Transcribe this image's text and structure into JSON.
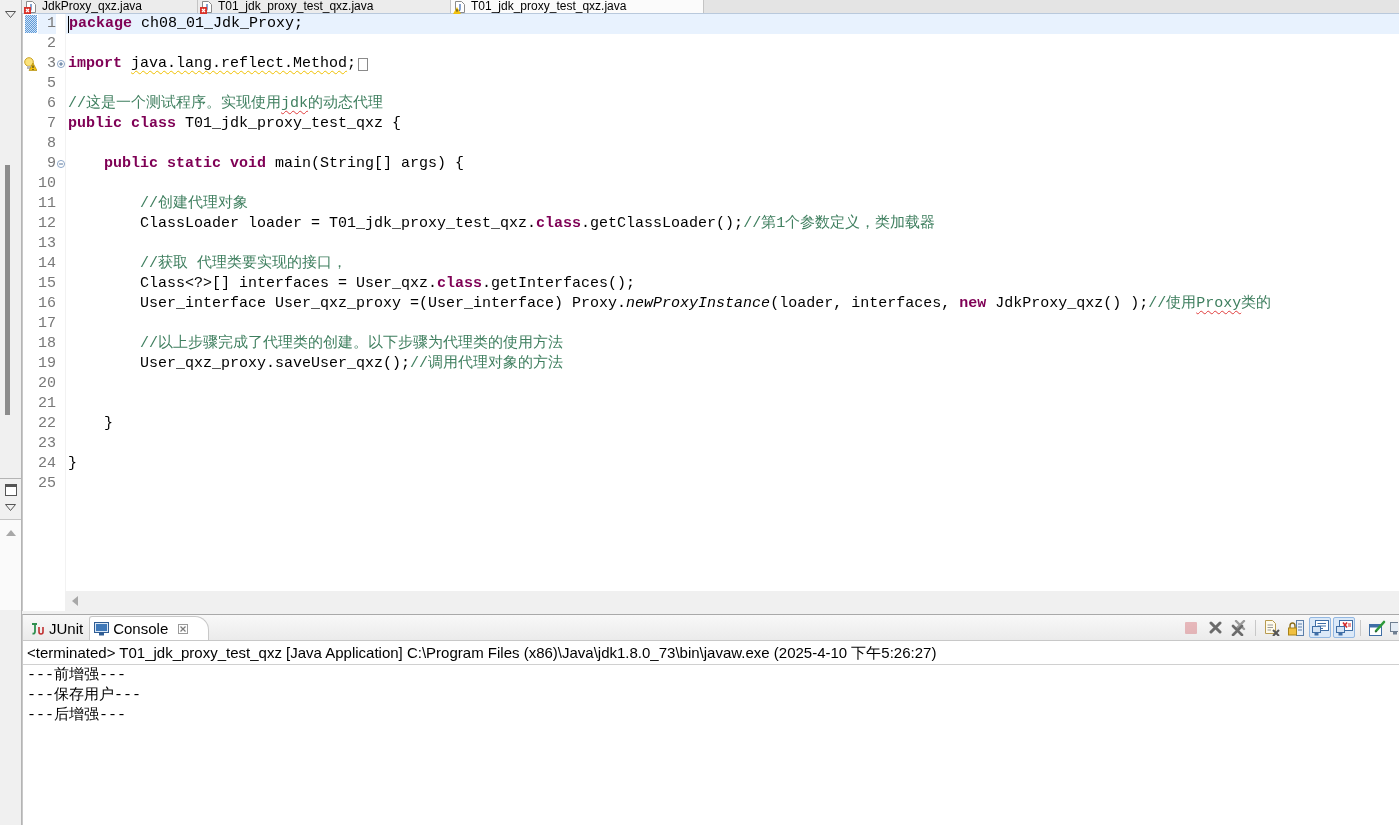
{
  "editor_tabs": [
    {
      "label": "JdkProxy_qxz.java",
      "selected": false,
      "kind": "error"
    },
    {
      "label": "T01_jdk_proxy_test_qxz.java",
      "selected": false,
      "kind": "error"
    },
    {
      "label": "T01_jdk_proxy_test_qxz.java",
      "selected": true,
      "kind": "warning"
    }
  ],
  "editor": {
    "lines": [
      {
        "number": "1",
        "current": true,
        "annotation": {
          "kind": "marker"
        },
        "spans": [
          {
            "kind": "keyword",
            "text": "package"
          },
          {
            "kind": "plain",
            "text": " ch08_01_Jdk_Proxy;"
          }
        ]
      },
      {
        "number": "2",
        "current": false
      },
      {
        "number": "3",
        "current": false,
        "annotation": {
          "kind": "warning"
        },
        "fold": {
          "expanded": false
        },
        "spans": [
          {
            "kind": "keyword",
            "text": "import "
          },
          {
            "kind": "warning",
            "text": "java.lang.reflect.Method"
          },
          {
            "kind": "plain",
            "text": ";"
          }
        ]
      },
      {
        "number": "5",
        "current": false
      },
      {
        "number": "6",
        "current": false,
        "spans": [
          {
            "kind": "comment",
            "text": "//这是一个测试程序。实现使用"
          },
          {
            "kind": "typo",
            "text": "jdk"
          },
          {
            "kind": "comment",
            "text": "的动态代理"
          }
        ]
      },
      {
        "number": "7",
        "current": false,
        "spans": [
          {
            "kind": "keyword",
            "text": "public class"
          },
          {
            "kind": "plain",
            "text": " T01_jdk_proxy_test_qxz {"
          }
        ]
      },
      {
        "number": "8",
        "current": false
      },
      {
        "number": "9",
        "current": false,
        "fold": {
          "expanded": true
        },
        "spans": [
          {
            "kind": "keyword",
            "text": "    public static void"
          },
          {
            "kind": "plain",
            "text": " main(String[] args) {"
          }
        ]
      },
      {
        "number": "10",
        "current": false
      },
      {
        "number": "11",
        "current": false,
        "spans": [
          {
            "kind": "comment",
            "text": "        //创建代理对象"
          }
        ]
      },
      {
        "number": "12",
        "current": false,
        "spans": [
          {
            "kind": "plain",
            "text": "        ClassLoader loader = T01_jdk_proxy_test_qxz."
          },
          {
            "kind": "keyword",
            "text": "class"
          },
          {
            "kind": "plain",
            "text": ".getClassLoader();"
          },
          {
            "kind": "comment",
            "text": "//第1个参数定义，类加载器"
          }
        ]
      },
      {
        "number": "13",
        "current": false
      },
      {
        "number": "14",
        "current": false,
        "spans": [
          {
            "kind": "comment",
            "text": "        //获取 代理类要实现的接口，"
          }
        ]
      },
      {
        "number": "15",
        "current": false,
        "spans": [
          {
            "kind": "plain",
            "text": "        Class<?>[] interfaces = User_qxz."
          },
          {
            "kind": "keyword",
            "text": "class"
          },
          {
            "kind": "plain",
            "text": ".getInterfaces();"
          }
        ]
      },
      {
        "number": "16",
        "current": false,
        "spans": [
          {
            "kind": "plain",
            "text": "        User_interface User_qxz_proxy =(User_interface) Proxy."
          },
          {
            "kind": "static",
            "text": "newProxyInstance"
          },
          {
            "kind": "plain",
            "text": "(loader, interfaces, "
          },
          {
            "kind": "keyword",
            "text": "new"
          },
          {
            "kind": "plain",
            "text": " JdkProxy_qxz() );"
          },
          {
            "kind": "comment",
            "text": "//使用"
          },
          {
            "kind": "typo",
            "text": "Proxy"
          },
          {
            "kind": "comment",
            "text": "类的"
          }
        ]
      },
      {
        "number": "17",
        "current": false
      },
      {
        "number": "18",
        "current": false,
        "spans": [
          {
            "kind": "comment",
            "text": "        //以上步骤完成了代理类的创建。以下步骤为代理类的使用方法"
          }
        ]
      },
      {
        "number": "19",
        "current": false,
        "spans": [
          {
            "kind": "plain",
            "text": "        User_qxz_proxy.saveUser_qxz();"
          },
          {
            "kind": "comment",
            "text": "//调用代理对象的方法"
          }
        ]
      },
      {
        "number": "20",
        "current": false
      },
      {
        "number": "21",
        "current": false
      },
      {
        "number": "22",
        "current": false,
        "spans": [
          {
            "kind": "plain",
            "text": "    }"
          }
        ]
      },
      {
        "number": "23",
        "current": false
      },
      {
        "number": "24",
        "current": false,
        "spans": [
          {
            "kind": "plain",
            "text": "}"
          }
        ]
      },
      {
        "number": "25",
        "current": false
      }
    ]
  },
  "console": {
    "tabs": [
      {
        "label": "JUnit",
        "selected": false
      },
      {
        "label": "Console",
        "selected": true
      }
    ],
    "toolbar": [
      [
        {
          "disabled": true,
          "pressed": false
        },
        {
          "disabled": false,
          "pressed": false
        },
        {
          "disabled": false,
          "pressed": false
        }
      ],
      [
        {
          "disabled": false,
          "pressed": false
        },
        {
          "disabled": false,
          "pressed": false
        },
        {
          "disabled": false,
          "pressed": true
        },
        {
          "disabled": false,
          "pressed": true
        }
      ],
      [
        {
          "disabled": false,
          "pressed": false
        },
        {
          "disabled": false,
          "pressed": false
        }
      ]
    ],
    "process": "<terminated> T01_jdk_proxy_test_qxz [Java Application] C:\\Program Files (x86)\\Java\\jdk1.8.0_73\\bin\\javaw.exe (2025-4-10 下午5:26:27)",
    "output": [
      "---前增强---",
      "---保存用户---",
      "---后增强---"
    ]
  }
}
